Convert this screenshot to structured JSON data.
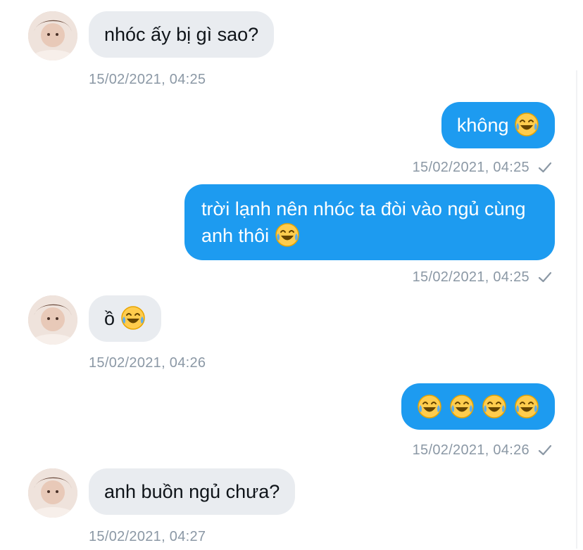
{
  "messages": [
    {
      "dir": "in",
      "text": "nhóc ấy bị gì sao?",
      "time": "15/02/2021, 04:25"
    },
    {
      "dir": "out",
      "text": "không",
      "emoji": "joy-emoji",
      "time": "15/02/2021, 04:25"
    },
    {
      "dir": "out",
      "text": "trời lạnh nên nhóc ta đòi vào ngủ cùng anh thôi",
      "emoji": "joy-emoji",
      "time": "15/02/2021, 04:25"
    },
    {
      "dir": "in",
      "text": "ồ",
      "emoji": "joy-emoji",
      "time": "15/02/2021, 04:26"
    },
    {
      "dir": "out",
      "text": "",
      "emoji_count": 4,
      "emoji": "joy-emoji",
      "time": "15/02/2021, 04:26"
    },
    {
      "dir": "in",
      "text": "anh buồn ngủ chưa?",
      "time": "15/02/2021, 04:27"
    }
  ],
  "icons": {
    "sent_status": "check-icon",
    "avatar": "avatar"
  },
  "colors": {
    "outgoing_bubble": "#1d9bf0",
    "incoming_bubble": "#e9ecf0",
    "meta_text": "#8b98a5"
  }
}
